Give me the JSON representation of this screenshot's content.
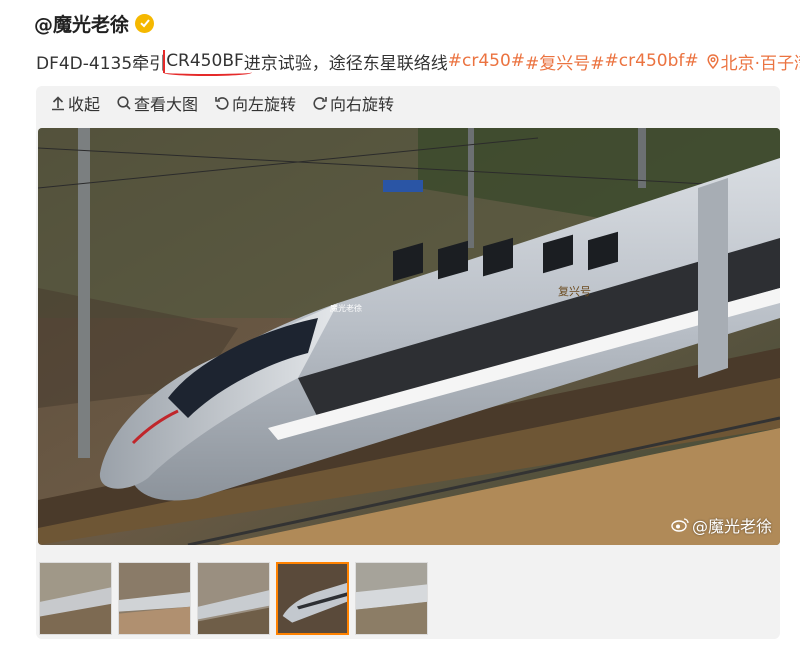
{
  "post": {
    "author": "@魔光老徐",
    "text_prefix": "DF4D-4135牵引",
    "text_highlight": "CR450BF",
    "text_suffix": "进京试验，途径东星联络线",
    "tags": [
      "#cr450#",
      "#复兴号#",
      "#cr450bf#"
    ],
    "location": "北京·百子湾"
  },
  "toolbar": {
    "collapse": "收起",
    "view_large": "查看大图",
    "rotate_left": "向左旋转",
    "rotate_right": "向右旋转"
  },
  "photo": {
    "watermark": "@魔光老徐",
    "train_logo": "魔光老徐",
    "train_name": "复兴号"
  },
  "thumbnails": {
    "count": 5,
    "active_index": 3
  },
  "colors": {
    "tag": "#eb7340",
    "highlight_mark": "#e52a2a",
    "active_thumb_border": "#ff8200",
    "verified_badge": "#f5b800"
  }
}
